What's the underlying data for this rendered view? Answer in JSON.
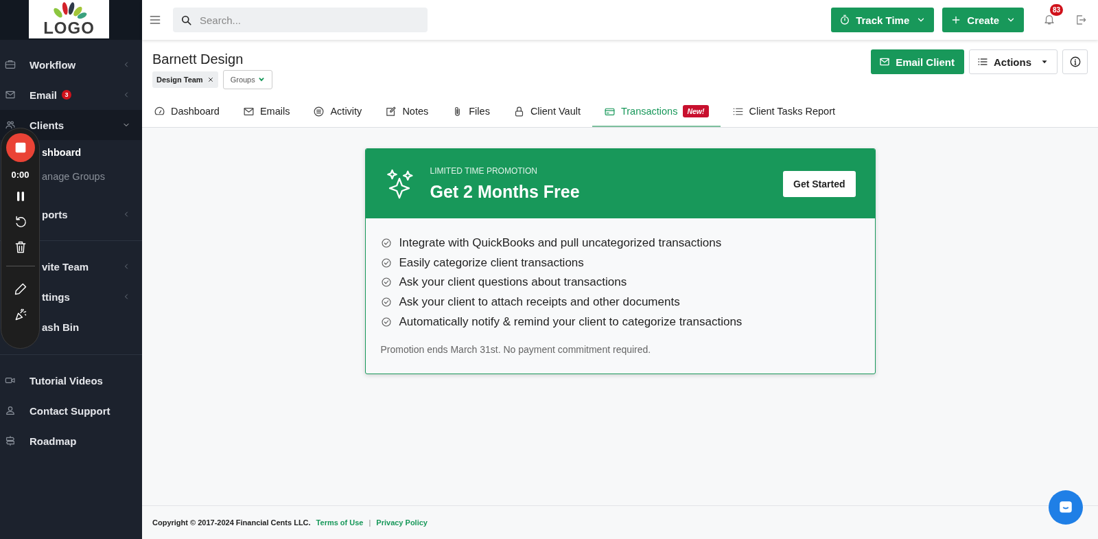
{
  "logo": {
    "text": "LOGO"
  },
  "sidebar": {
    "sections": [
      {
        "items": [
          {
            "label": "Workflow",
            "expanded": false
          },
          {
            "label": "Email",
            "badge": "3",
            "expanded": false
          },
          {
            "label": "Clients",
            "expanded": true,
            "children": [
              {
                "label": "shboard",
                "selected": true,
                "covered": true
              },
              {
                "label": "anage Groups",
                "selected": false,
                "covered": true
              }
            ]
          },
          {
            "label": "ports",
            "expanded": false,
            "covered": true
          }
        ]
      },
      {
        "items": [
          {
            "label": "vite Team",
            "expanded": false,
            "covered": true
          },
          {
            "label": "ttings",
            "expanded": false,
            "covered": true
          },
          {
            "label": "ash Bin",
            "covered": true
          }
        ]
      },
      {
        "items": [
          {
            "label": "Tutorial Videos"
          },
          {
            "label": "Contact Support"
          },
          {
            "label": "Roadmap"
          }
        ]
      }
    ]
  },
  "recorder": {
    "time": "0:00"
  },
  "topbar": {
    "search": {
      "placeholder": "Search..."
    },
    "buttons": [
      {
        "label": "Track Time"
      },
      {
        "label": "Create"
      }
    ],
    "notifications": {
      "count": "83"
    }
  },
  "client": {
    "name": "Barnett Design",
    "tags": [
      {
        "label": "Design Team"
      }
    ],
    "groups_button": "Groups",
    "email_button": "Email Client",
    "actions_button": "Actions"
  },
  "tabs": [
    {
      "label": "Dashboard",
      "selected": false
    },
    {
      "label": "Emails",
      "selected": false
    },
    {
      "label": "Activity",
      "selected": false
    },
    {
      "label": "Notes",
      "selected": false
    },
    {
      "label": "Files",
      "selected": false
    },
    {
      "label": "Client Vault",
      "selected": false
    },
    {
      "label": "Transactions",
      "selected": true,
      "badge": "New!"
    },
    {
      "label": "Client Tasks Report",
      "selected": false
    }
  ],
  "promo": {
    "eyebrow": "LIMITED TIME PROMOTION",
    "title": "Get 2 Months Free",
    "button": "Get Started",
    "features": [
      "Integrate with QuickBooks and pull uncategorized transactions",
      "Easily categorize client transactions",
      "Ask your client questions about transactions",
      "Ask your client to attach receipts and other documents",
      "Automatically notify & remind your client to categorize transactions"
    ],
    "note": "Promotion ends March 31st. No payment commitment required."
  },
  "footer": {
    "copyright": "Copyright © 2017-2024 Financial Cents LLC.",
    "links": [
      "Terms of Use",
      "Privacy Policy"
    ],
    "separator": "|"
  }
}
